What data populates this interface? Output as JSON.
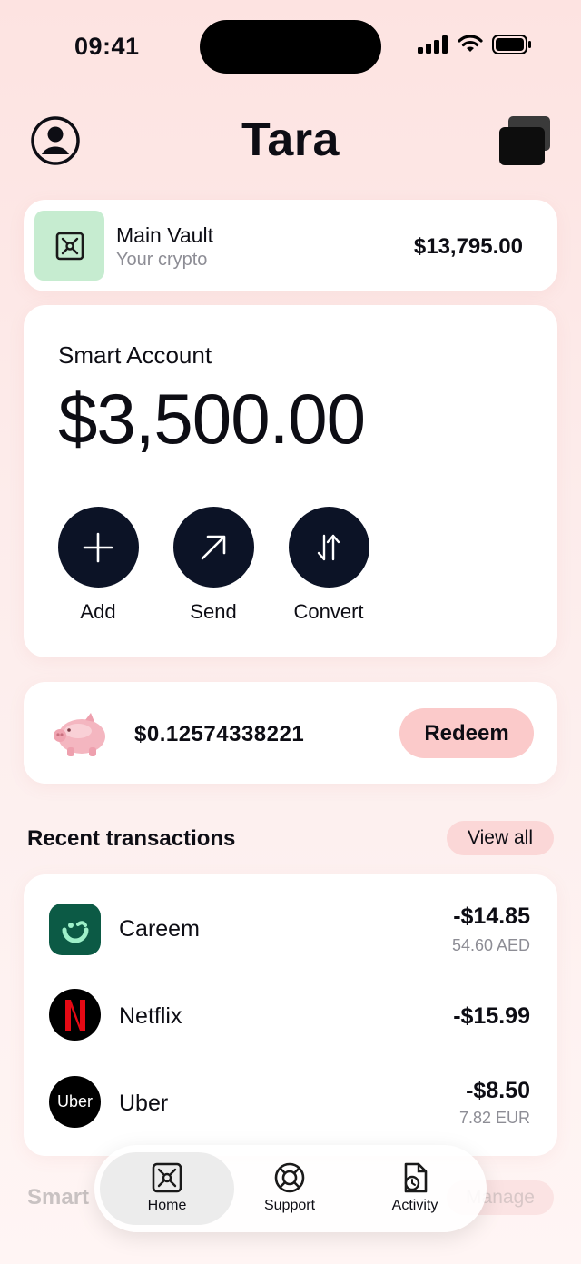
{
  "status": {
    "time": "09:41"
  },
  "header": {
    "title": "Tara"
  },
  "vault": {
    "name": "Main Vault",
    "subtitle": "Your crypto",
    "amount": "$13,795.00"
  },
  "smart_account": {
    "label": "Smart Account",
    "balance": "$3,500.00",
    "actions": [
      {
        "label": "Add",
        "icon": "plus-icon"
      },
      {
        "label": "Send",
        "icon": "arrow-up-right-icon"
      },
      {
        "label": "Convert",
        "icon": "swap-arrows-icon"
      }
    ]
  },
  "savings": {
    "amount": "$0.12574338221",
    "button": "Redeem",
    "icon": "piggy-bank-icon"
  },
  "recent": {
    "title": "Recent transactions",
    "view_all": "View all",
    "transactions": [
      {
        "merchant": "Careem",
        "amount": "-$14.85",
        "original": "54.60 AED",
        "logo_color": "#0c5a45"
      },
      {
        "merchant": "Netflix",
        "amount": "-$15.99",
        "original": "",
        "logo_color": "#000000"
      },
      {
        "merchant": "Uber",
        "amount": "-$8.50",
        "original": "7.82 EUR",
        "logo_color": "#000000",
        "logo_text": "Uber"
      }
    ]
  },
  "under_tabbar": {
    "left": "Smart",
    "right": "Manage"
  },
  "tabbar": {
    "items": [
      {
        "label": "Home",
        "icon": "vault-icon",
        "active": true
      },
      {
        "label": "Support",
        "icon": "lifebuoy-icon",
        "active": false
      },
      {
        "label": "Activity",
        "icon": "document-clock-icon",
        "active": false
      }
    ]
  },
  "colors": {
    "accent_pink": "#fbcaca",
    "dark_navy": "#0c1326",
    "vault_green": "#c6ecd0"
  }
}
